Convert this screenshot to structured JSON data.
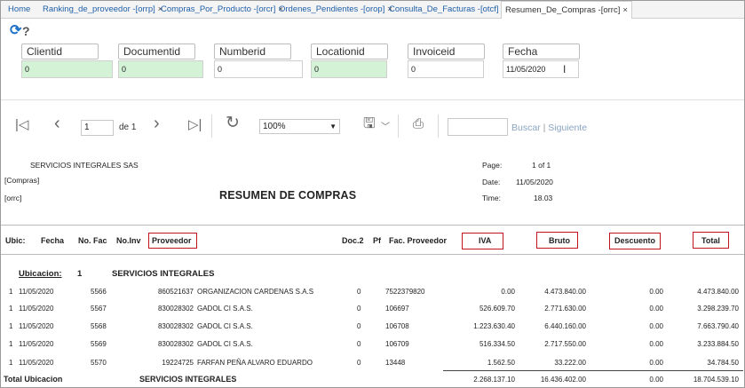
{
  "tabs": [
    {
      "label": "Home",
      "active": false,
      "closable": false
    },
    {
      "label": "Ranking_de_proveedor -[orrp]",
      "active": false,
      "closable": true
    },
    {
      "label": "Compras_Por_Producto -[orcr]",
      "active": false,
      "closable": true
    },
    {
      "label": "Ordenes_Pendientes -[orop]",
      "active": false,
      "closable": true
    },
    {
      "label": "Consulta_De_Facturas -[otcf]",
      "active": false,
      "closable": true
    },
    {
      "label": "Resumen_De_Compras -[orrc]",
      "active": true,
      "closable": true
    }
  ],
  "close_glyph": "×",
  "header_icons": {
    "refresh": "⟳",
    "help": "?"
  },
  "params": [
    {
      "label": "Clientid",
      "value": "0",
      "highlight": true
    },
    {
      "label": "Documentid",
      "value": "0",
      "highlight": true
    },
    {
      "label": "Numberid",
      "value": "0",
      "highlight": false
    },
    {
      "label": "Locationid",
      "value": "0",
      "highlight": true
    },
    {
      "label": "Invoiceid",
      "value": "0",
      "highlight": false
    },
    {
      "label": "Fecha",
      "value": "11/05/2020",
      "highlight": false
    }
  ],
  "viewer": {
    "page": "1",
    "of_label": "de 1",
    "zoom": "100%",
    "search_placeholder": "",
    "buscar": "Buscar",
    "separator": "|",
    "siguiente": "Siguiente"
  },
  "report": {
    "company": "SERVICIOS INTEGRALES SAS",
    "module": "[Compras]",
    "code": "[orrc]",
    "title": "RESUMEN DE COMPRAS",
    "page_label": "Page:",
    "page_value": "1 of 1",
    "date_label": "Date:",
    "date_value": "11/05/2020",
    "time_label": "Time:",
    "time_value": "18.03",
    "columns": {
      "ubic": "Ubic:",
      "fecha": "Fecha",
      "nofac": "No. Fac",
      "noinv": "No.Inv",
      "proveedor": "Proveedor",
      "doc2": "Doc.2",
      "pf": "Pf",
      "facprov": "Fac. Proveedor",
      "iva": "IVA",
      "bruto": "Bruto",
      "descuento": "Descuento",
      "total": "Total"
    },
    "group": {
      "label": "Ubicacion:",
      "number": "1",
      "name": "SERVICIOS INTEGRALES"
    },
    "rows": [
      {
        "ubic": "1",
        "fecha": "11/05/2020",
        "nofac": "5566",
        "noinv": "860521637",
        "proveedor": "ORGANIZACION CARDENAS S.A.S",
        "doc2": "0",
        "facprov": "7522379820",
        "iva": "0.00",
        "bruto": "4.473.840.00",
        "descuento": "0.00",
        "total": "4.473.840.00"
      },
      {
        "ubic": "1",
        "fecha": "11/05/2020",
        "nofac": "5567",
        "noinv": "830028302",
        "proveedor": "GADOL CI S.A.S.",
        "doc2": "0",
        "facprov": "106697",
        "iva": "526.609.70",
        "bruto": "2.771.630.00",
        "descuento": "0.00",
        "total": "3.298.239.70"
      },
      {
        "ubic": "1",
        "fecha": "11/05/2020",
        "nofac": "5568",
        "noinv": "830028302",
        "proveedor": "GADOL CI S.A.S.",
        "doc2": "0",
        "facprov": "106708",
        "iva": "1.223.630.40",
        "bruto": "6.440.160.00",
        "descuento": "0.00",
        "total": "7.663.790.40"
      },
      {
        "ubic": "1",
        "fecha": "11/05/2020",
        "nofac": "5569",
        "noinv": "830028302",
        "proveedor": "GADOL CI S.A.S.",
        "doc2": "0",
        "facprov": "106709",
        "iva": "516.334.50",
        "bruto": "2.717.550.00",
        "descuento": "0.00",
        "total": "3.233.884.50"
      },
      {
        "ubic": "1",
        "fecha": "11/05/2020",
        "nofac": "5570",
        "noinv": "19224725",
        "proveedor": "FARFAN PEÑA  ALVARO EDUARDO",
        "doc2": "0",
        "facprov": "13448",
        "iva": "1.562.50",
        "bruto": "33.222.00",
        "descuento": "0.00",
        "total": "34.784.50"
      }
    ],
    "totals": {
      "label": "Total Ubicacion",
      "name": "SERVICIOS INTEGRALES",
      "iva": "2.268.137.10",
      "bruto": "16.436.402.00",
      "descuento": "0.00",
      "total": "18.704.539.10"
    }
  },
  "colors": {
    "link": "#1f5fa8",
    "highlight_box": "#c1121f",
    "param_green": "#d4f3d6",
    "refresh": "#1f72c8"
  }
}
